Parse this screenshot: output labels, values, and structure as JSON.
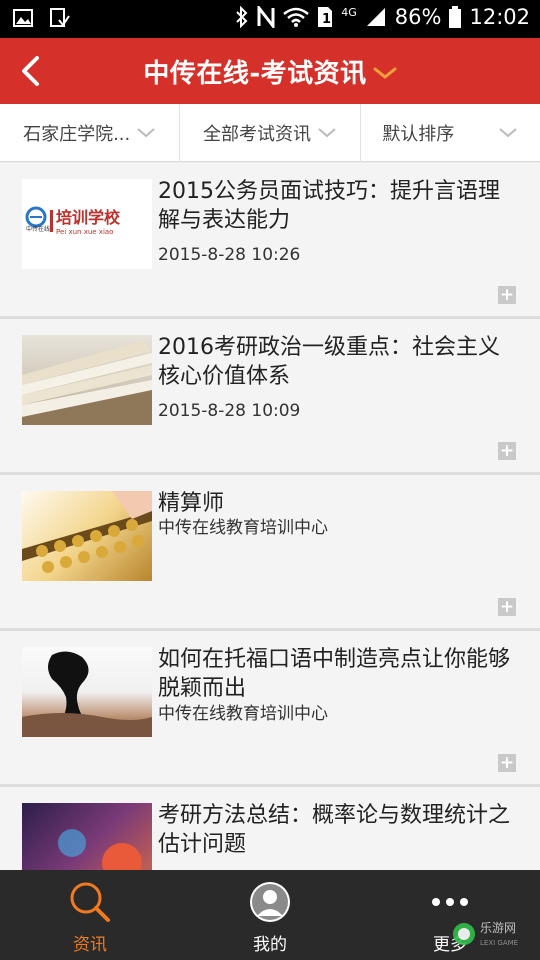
{
  "status_bar": {
    "battery": "86%",
    "time": "12:02",
    "network": "4G",
    "icons": [
      "image-icon",
      "download-icon",
      "bluetooth-icon",
      "nfc-icon",
      "wifi-icon",
      "sim-icon",
      "signal-icon",
      "battery-icon"
    ]
  },
  "header": {
    "title": "中传在线-考试资讯",
    "back_icon": "chevron-left-icon",
    "title_caret_icon": "chevron-down-icon",
    "bg_color": "#d5302a"
  },
  "filters": [
    {
      "label": "石家庄学院..."
    },
    {
      "label": "全部考试资讯"
    },
    {
      "label": "默认排序"
    }
  ],
  "news": [
    {
      "title": "2015公务员面试技巧：提升言语理解与表达能力",
      "meta": "2015-8-28  10:26",
      "thumb": "training-school-logo",
      "logo_cn": "培训学校",
      "logo_small": "中传在线",
      "logo_pinyin": "Pei xun xue xiao"
    },
    {
      "title": "2016考研政治一级重点：社会主义核心价值体系",
      "meta": "2015-8-28  10:09",
      "thumb": "books-image"
    },
    {
      "title": "精算师",
      "meta": "中传在线教育培训中心",
      "thumb": "abacus-image"
    },
    {
      "title": "如何在托福口语中制造亮点让你能够脱颖而出",
      "meta": "中传在线教育培训中心",
      "thumb": "rock-silhouette-image"
    },
    {
      "title": "考研方法总结：概率论与数理统计之估计问题",
      "meta": "",
      "thumb": "cartoon-image"
    }
  ],
  "tabs": [
    {
      "label": "资讯",
      "icon": "search-icon",
      "active": true
    },
    {
      "label": "我的",
      "icon": "user-avatar-icon",
      "active": false
    },
    {
      "label": "更多",
      "icon": "more-dots-icon",
      "active": false
    }
  ],
  "watermark": {
    "text": "乐游网",
    "subtext": "LEXI GAME"
  },
  "colors": {
    "accent": "#f07a22",
    "tabbar": "#2a2a2a"
  }
}
